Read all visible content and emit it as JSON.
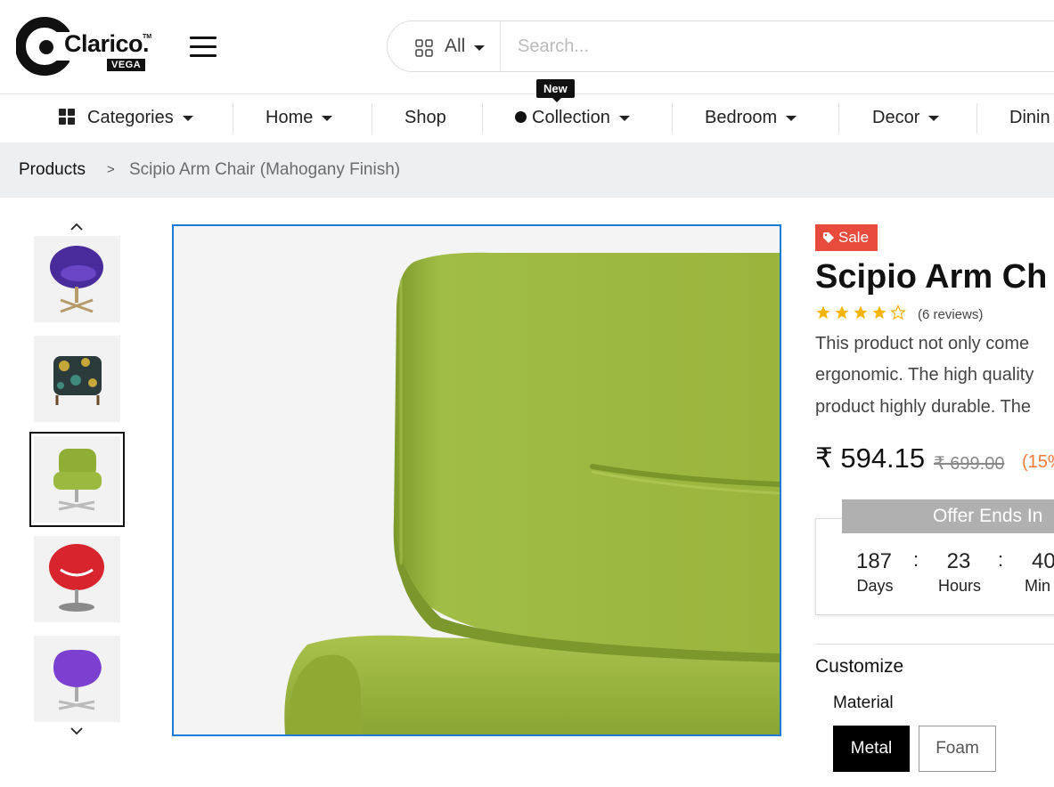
{
  "brand": {
    "name": "Clarico.",
    "tm": "TM",
    "sub": "VEGA"
  },
  "search": {
    "category": "All",
    "placeholder": "Search..."
  },
  "nav": {
    "categories": "Categories",
    "home": "Home",
    "shop": "Shop",
    "collection": "Collection",
    "collection_badge": "New",
    "bedroom": "Bedroom",
    "decor": "Decor",
    "dining": "Dinin"
  },
  "breadcrumb": {
    "parent": "Products",
    "separator": ">",
    "current": "Scipio Arm Chair (Mahogany Finish)"
  },
  "product": {
    "badge": "Sale",
    "title": "Scipio Arm Ch",
    "rating": 4,
    "rating_max": 5,
    "reviews": "(6 reviews)",
    "description_lines": [
      "This product not only come",
      "ergonomic. The high quality",
      "product highly durable. The"
    ],
    "price": "₹ 594.15",
    "old_price": "₹ 699.00",
    "discount": "(15%"
  },
  "offer": {
    "heading": "Offer Ends In",
    "days": "187",
    "days_label": "Days",
    "hours": "23",
    "hours_label": "Hours",
    "minutes": "40",
    "minutes_label": "Min",
    "separator": ":"
  },
  "customize": {
    "heading": "Customize",
    "material_label": "Material",
    "options": [
      "Metal",
      "Foam"
    ],
    "selected": "Metal"
  },
  "thumbnails": [
    {
      "name": "purple-egg-chair",
      "color": "#4a2b9c"
    },
    {
      "name": "floral-armchair",
      "color": "#2b3a3a"
    },
    {
      "name": "green-swivel-chair",
      "color": "#8fae35"
    },
    {
      "name": "red-egg-chair",
      "color": "#d8242c"
    },
    {
      "name": "violet-swan-chair",
      "color": "#7c3fd0"
    }
  ],
  "colors": {
    "accent_border": "#1a7cd6",
    "sale": "#e84b3c",
    "discount": "#ee7b3b",
    "star": "#f5b400",
    "chair_green": "#9bb83f"
  },
  "icons": [
    "menu-icon",
    "grid-icon",
    "chevron-up-icon",
    "chevron-down-icon",
    "tag-icon",
    "star-icon"
  ]
}
